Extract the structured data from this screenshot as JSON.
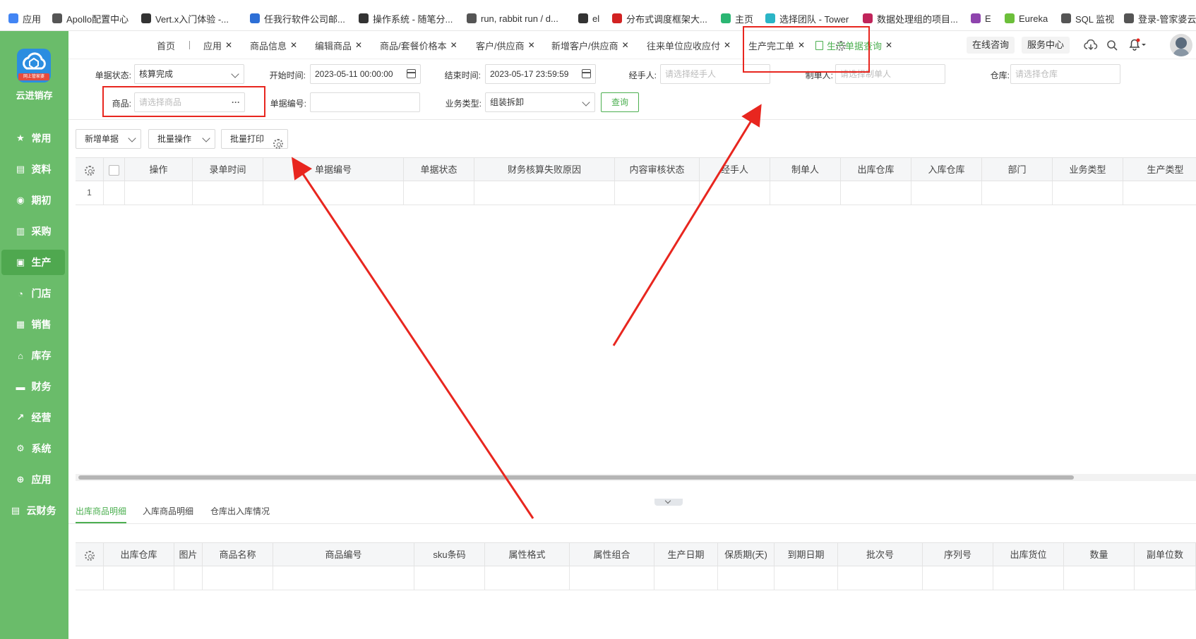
{
  "bookmarks": [
    {
      "label": "应用",
      "icon": "apps-grid-icon",
      "color": "#4285f4"
    },
    {
      "label": "Apollo配置中心",
      "icon": "apollo-icon",
      "color": "#555555"
    },
    {
      "label": "Vert.x入门体验 -...",
      "icon": "vertx-icon",
      "color": "#333333"
    },
    {
      "label": "任我行软件公司邮...",
      "icon": "mail-icon",
      "color": "#2d6fd6"
    },
    {
      "label": "操作系统 - 随笔分...",
      "icon": "blog-icon",
      "color": "#333333"
    },
    {
      "label": "run, rabbit run / d...",
      "icon": "globe-icon",
      "color": "#555555"
    },
    {
      "label": "el",
      "icon": "vertx-icon",
      "color": "#333333"
    },
    {
      "label": "分布式调度框架大...",
      "icon": "c-brand-icon",
      "color": "#d22222"
    },
    {
      "label": "主页",
      "icon": "v-brand-icon",
      "color": "#2bb673"
    },
    {
      "label": "选择团队 - Tower",
      "icon": "tower-icon",
      "color": "#2bb5c6"
    },
    {
      "label": "数据处理组的项目...",
      "icon": "project-icon",
      "color": "#c0245a"
    },
    {
      "label": "E",
      "icon": "tr-icon",
      "color": "#8e44ad"
    },
    {
      "label": "Eureka",
      "icon": "leaf-icon",
      "color": "#6cbf3a"
    },
    {
      "label": "SQL 监视",
      "icon": "globe-icon",
      "color": "#555555"
    },
    {
      "label": "登录-管家婆云",
      "icon": "globe-icon",
      "color": "#555555"
    }
  ],
  "sidebar": {
    "brand": "云进销存",
    "badge": "网上管家婆",
    "items": [
      {
        "label": "常用",
        "icon": "star-icon"
      },
      {
        "label": "资料",
        "icon": "document-icon"
      },
      {
        "label": "期初",
        "icon": "target-icon"
      },
      {
        "label": "采购",
        "icon": "purchase-icon"
      },
      {
        "label": "生产",
        "icon": "production-icon",
        "active": true
      },
      {
        "label": "门店",
        "icon": "pie-icon"
      },
      {
        "label": "销售",
        "icon": "bar-chart-icon"
      },
      {
        "label": "库存",
        "icon": "house-icon"
      },
      {
        "label": "财务",
        "icon": "wallet-icon"
      },
      {
        "label": "经营",
        "icon": "trend-icon"
      },
      {
        "label": "系统",
        "icon": "settings-icon"
      },
      {
        "label": "应用",
        "icon": "plus-icon"
      },
      {
        "label": "云财务",
        "icon": "cloud-finance-icon"
      }
    ]
  },
  "tabs": {
    "items": [
      {
        "label": "首页",
        "closable": false
      },
      {
        "label": "应用",
        "closable": true
      },
      {
        "label": "商品信息",
        "closable": true
      },
      {
        "label": "编辑商品",
        "closable": true
      },
      {
        "label": "商品/套餐价格本",
        "closable": true
      },
      {
        "label": "客户/供应商",
        "closable": true
      },
      {
        "label": "新增客户/供应商",
        "closable": true
      },
      {
        "label": "往来单位应收应付",
        "closable": true
      },
      {
        "label": "生产完工单",
        "closable": true
      },
      {
        "label": "生产单据查询",
        "closable": true,
        "active": true
      }
    ],
    "online_consult": "在线咨询",
    "service_center": "服务中心"
  },
  "filters": {
    "status_label": "单据状态:",
    "status_value": "核算完成",
    "start_label": "开始时间:",
    "start_value": "2023-05-11 00:00:00",
    "end_label": "结束时间:",
    "end_value": "2023-05-17 23:59:59",
    "handler_label": "经手人:",
    "handler_placeholder": "请选择经手人",
    "maker_label": "制单人:",
    "maker_placeholder": "请选择制单人",
    "warehouse_label": "仓库:",
    "warehouse_placeholder": "请选择仓库",
    "product_label": "商品:",
    "product_placeholder": "请选择商品",
    "product_more": "···",
    "docno_label": "单据编号:",
    "biztype_label": "业务类型:",
    "biztype_value": "组装拆卸",
    "query_button": "查询"
  },
  "toolbar": {
    "new_doc": "新增单据",
    "batch_ops": "批量操作",
    "batch_print": "批量打印"
  },
  "main_table": {
    "columns": [
      "操作",
      "录单时间",
      "单据编号",
      "单据状态",
      "财务核算失败原因",
      "内容审核状态",
      "经手人",
      "制单人",
      "出库仓库",
      "入库仓库",
      "部门",
      "业务类型",
      "生产类型"
    ],
    "rows": [
      {
        "index": "1"
      }
    ]
  },
  "detail_tabs": [
    "出库商品明细",
    "入库商品明细",
    "仓库出入库情况"
  ],
  "detail_table": {
    "columns": [
      "出库仓库",
      "图片",
      "商品名称",
      "商品编号",
      "sku条码",
      "属性格式",
      "属性组合",
      "生产日期",
      "保质期(天)",
      "到期日期",
      "批次号",
      "序列号",
      "出库货位",
      "数量",
      "副单位数"
    ]
  },
  "annotation_color": "#e8261f",
  "accent_color": "#4caf50",
  "sidebar_color": "#6abc6a"
}
